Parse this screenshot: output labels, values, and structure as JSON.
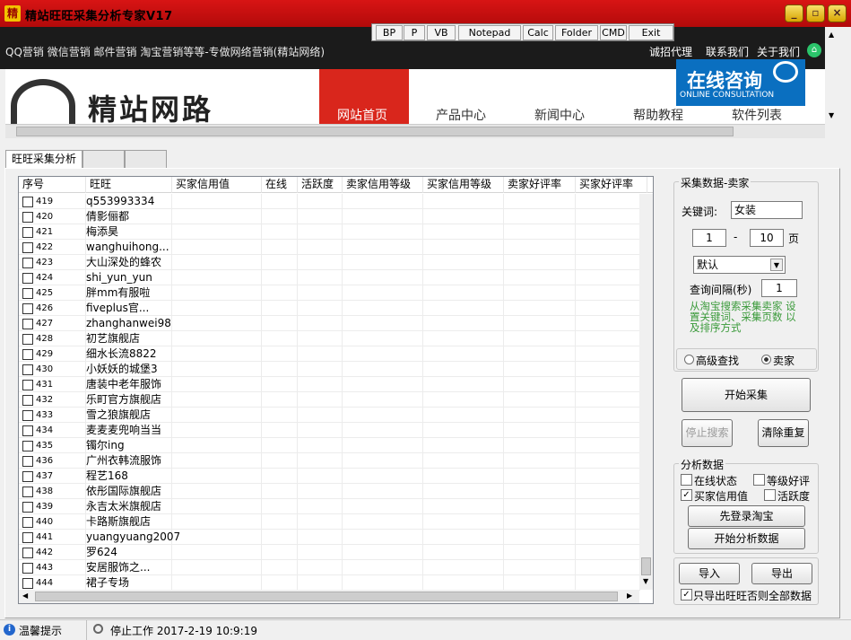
{
  "app": {
    "title": "精站旺旺采集分析专家V17",
    "icon_glyph": "精"
  },
  "window_controls": {
    "minimize": "_",
    "restore": "▫",
    "close": "×"
  },
  "toolbar": [
    "BP",
    "P",
    "VB",
    "Notepad",
    "Calc",
    "Folder",
    "CMD",
    "Exit"
  ],
  "web": {
    "top_links": "QQ营销  微信营销  邮件营销  淘宝营销等等-专做网络营销(精站网络)",
    "recruit": "诚招代理",
    "contact": "联系我们",
    "about": "关于我们",
    "logo_text": "精站网路",
    "nav": [
      "网站首页",
      "产品中心",
      "新闻中心",
      "帮助教程",
      "软件列表"
    ],
    "consult_cn": "在线咨询",
    "consult_en": "ONLINE CONSULTATION"
  },
  "tabs": [
    "旺旺采集分析",
    "",
    ""
  ],
  "grid": {
    "columns": [
      "序号",
      "旺旺",
      "买家信用值",
      "在线",
      "活跃度",
      "卖家信用等级",
      "买家信用等级",
      "卖家好评率",
      "买家好评率"
    ],
    "rows": [
      {
        "no": "419",
        "wangwang": "q553993334"
      },
      {
        "no": "420",
        "wangwang": "倩影俪都"
      },
      {
        "no": "421",
        "wangwang": "梅添昊"
      },
      {
        "no": "422",
        "wangwang": "wanghuihong..."
      },
      {
        "no": "423",
        "wangwang": "大山深处的蜂农"
      },
      {
        "no": "424",
        "wangwang": "shi_yun_yun"
      },
      {
        "no": "425",
        "wangwang": "胖mm有服啦"
      },
      {
        "no": "426",
        "wangwang": "fiveplus官..."
      },
      {
        "no": "427",
        "wangwang": "zhanghanwei98"
      },
      {
        "no": "428",
        "wangwang": "初艺旗舰店"
      },
      {
        "no": "429",
        "wangwang": "细水长流8822"
      },
      {
        "no": "430",
        "wangwang": "小妖妖的城堡3"
      },
      {
        "no": "431",
        "wangwang": "唐装中老年服饰"
      },
      {
        "no": "432",
        "wangwang": "乐町官方旗舰店"
      },
      {
        "no": "433",
        "wangwang": "雪之狼旗舰店"
      },
      {
        "no": "434",
        "wangwang": "麦麦麦兜响当当"
      },
      {
        "no": "435",
        "wangwang": "镯尔ing"
      },
      {
        "no": "436",
        "wangwang": "广州衣韩流服饰"
      },
      {
        "no": "437",
        "wangwang": "程艺168"
      },
      {
        "no": "438",
        "wangwang": "依彤国际旗舰店"
      },
      {
        "no": "439",
        "wangwang": "永吉太米旗舰店"
      },
      {
        "no": "440",
        "wangwang": "卡路斯旗舰店"
      },
      {
        "no": "441",
        "wangwang": "yuangyuang2007"
      },
      {
        "no": "442",
        "wangwang": "罗624"
      },
      {
        "no": "443",
        "wangwang": "安居服饰之..."
      },
      {
        "no": "444",
        "wangwang": "裙子专场"
      }
    ]
  },
  "collect": {
    "title": "采集数据-卖家",
    "keyword_label": "关键词:",
    "keyword_value": "女装",
    "page_from": "1",
    "page_sep": "-",
    "page_to": "10",
    "page_unit": "页",
    "sort_value": "默认",
    "interval_label": "查询间隔(秒)",
    "interval_value": "1",
    "hint": "从淘宝搜索采集卖家 设置关键词、采集页数 以及排序方式",
    "radio_advanced": "高级查找",
    "radio_seller": "卖家",
    "start_btn": "开始采集",
    "stop_btn": "停止搜索",
    "clear_btn": "清除重复"
  },
  "analysis": {
    "title": "分析数据",
    "online": "在线状态",
    "rating": "等级好评",
    "buyer_credit": "买家信用值",
    "activity": "活跃度",
    "login_btn": "先登录淘宝",
    "analyze_btn": "开始分析数据"
  },
  "export": {
    "import_btn": "导入",
    "export_btn": "导出",
    "only_ww": "只导出旺旺否则全部数据"
  },
  "status": {
    "tip": "温馨提示",
    "state": "停止工作 2017-2-19 10:9:19"
  },
  "colors": {
    "title_red": "#c8100f",
    "nav_red": "#d9261c",
    "consult_blue": "#0a6fc0"
  }
}
